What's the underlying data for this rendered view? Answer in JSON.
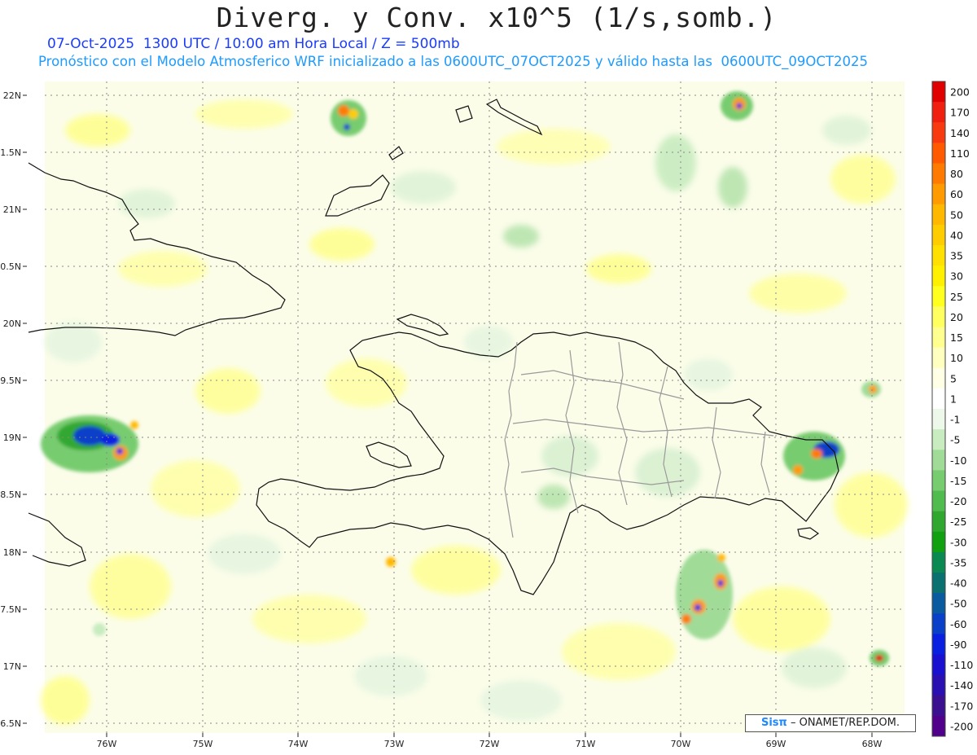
{
  "header": {
    "title": "Diverg. y Conv. x10^5 (1/s,somb.)",
    "subtitle_line1": "07-Oct-2025  1300 UTC / 10:00 am Hora Local / Z = 500mb",
    "subtitle_line2": "Pronóstico con el Modelo Atmosferico WRF inicializado a las 0600UTC_07OCT2025 y válido hasta las  0600UTC_09OCT2025"
  },
  "axes": {
    "lat_labels": [
      "22N",
      "1.5N",
      "21N",
      "0.5N",
      "20N",
      "9.5N",
      "19N",
      "8.5N",
      "18N",
      "7.5N",
      "17N",
      "6.5N"
    ],
    "lon_labels": [
      "76W",
      "75W",
      "74W",
      "73W",
      "72W",
      "71W",
      "70W",
      "69W",
      "68W"
    ]
  },
  "colorbar": {
    "labels": [
      "200",
      "170",
      "140",
      "110",
      "80",
      "60",
      "50",
      "40",
      "35",
      "30",
      "25",
      "20",
      "15",
      "10",
      "5",
      "1",
      "-1",
      "-5",
      "-10",
      "-15",
      "-20",
      "-25",
      "-30",
      "-35",
      "-40",
      "-50",
      "-60",
      "-90",
      "-110",
      "-140",
      "-170",
      "-200"
    ],
    "colors": [
      "#e00000",
      "#f02010",
      "#f83a10",
      "#ff5a00",
      "#ff7a00",
      "#ff9a00",
      "#ffb800",
      "#ffcc00",
      "#ffe000",
      "#fff000",
      "#ffff20",
      "#ffff60",
      "#ffff90",
      "#ffffc0",
      "#ffffe6",
      "#ffffff",
      "#eef8ea",
      "#c8ecc0",
      "#a0dc98",
      "#78cc70",
      "#50bc50",
      "#30a830",
      "#10a010",
      "#0a8a50",
      "#0a7070",
      "#0a5aa0",
      "#0a40c8",
      "#0a20e0",
      "#1a10d0",
      "#2a10b0",
      "#3a1090",
      "#50008a"
    ]
  },
  "credit": {
    "logo": "Sisπ",
    "text": "– ONAMET/REP.DOM."
  }
}
